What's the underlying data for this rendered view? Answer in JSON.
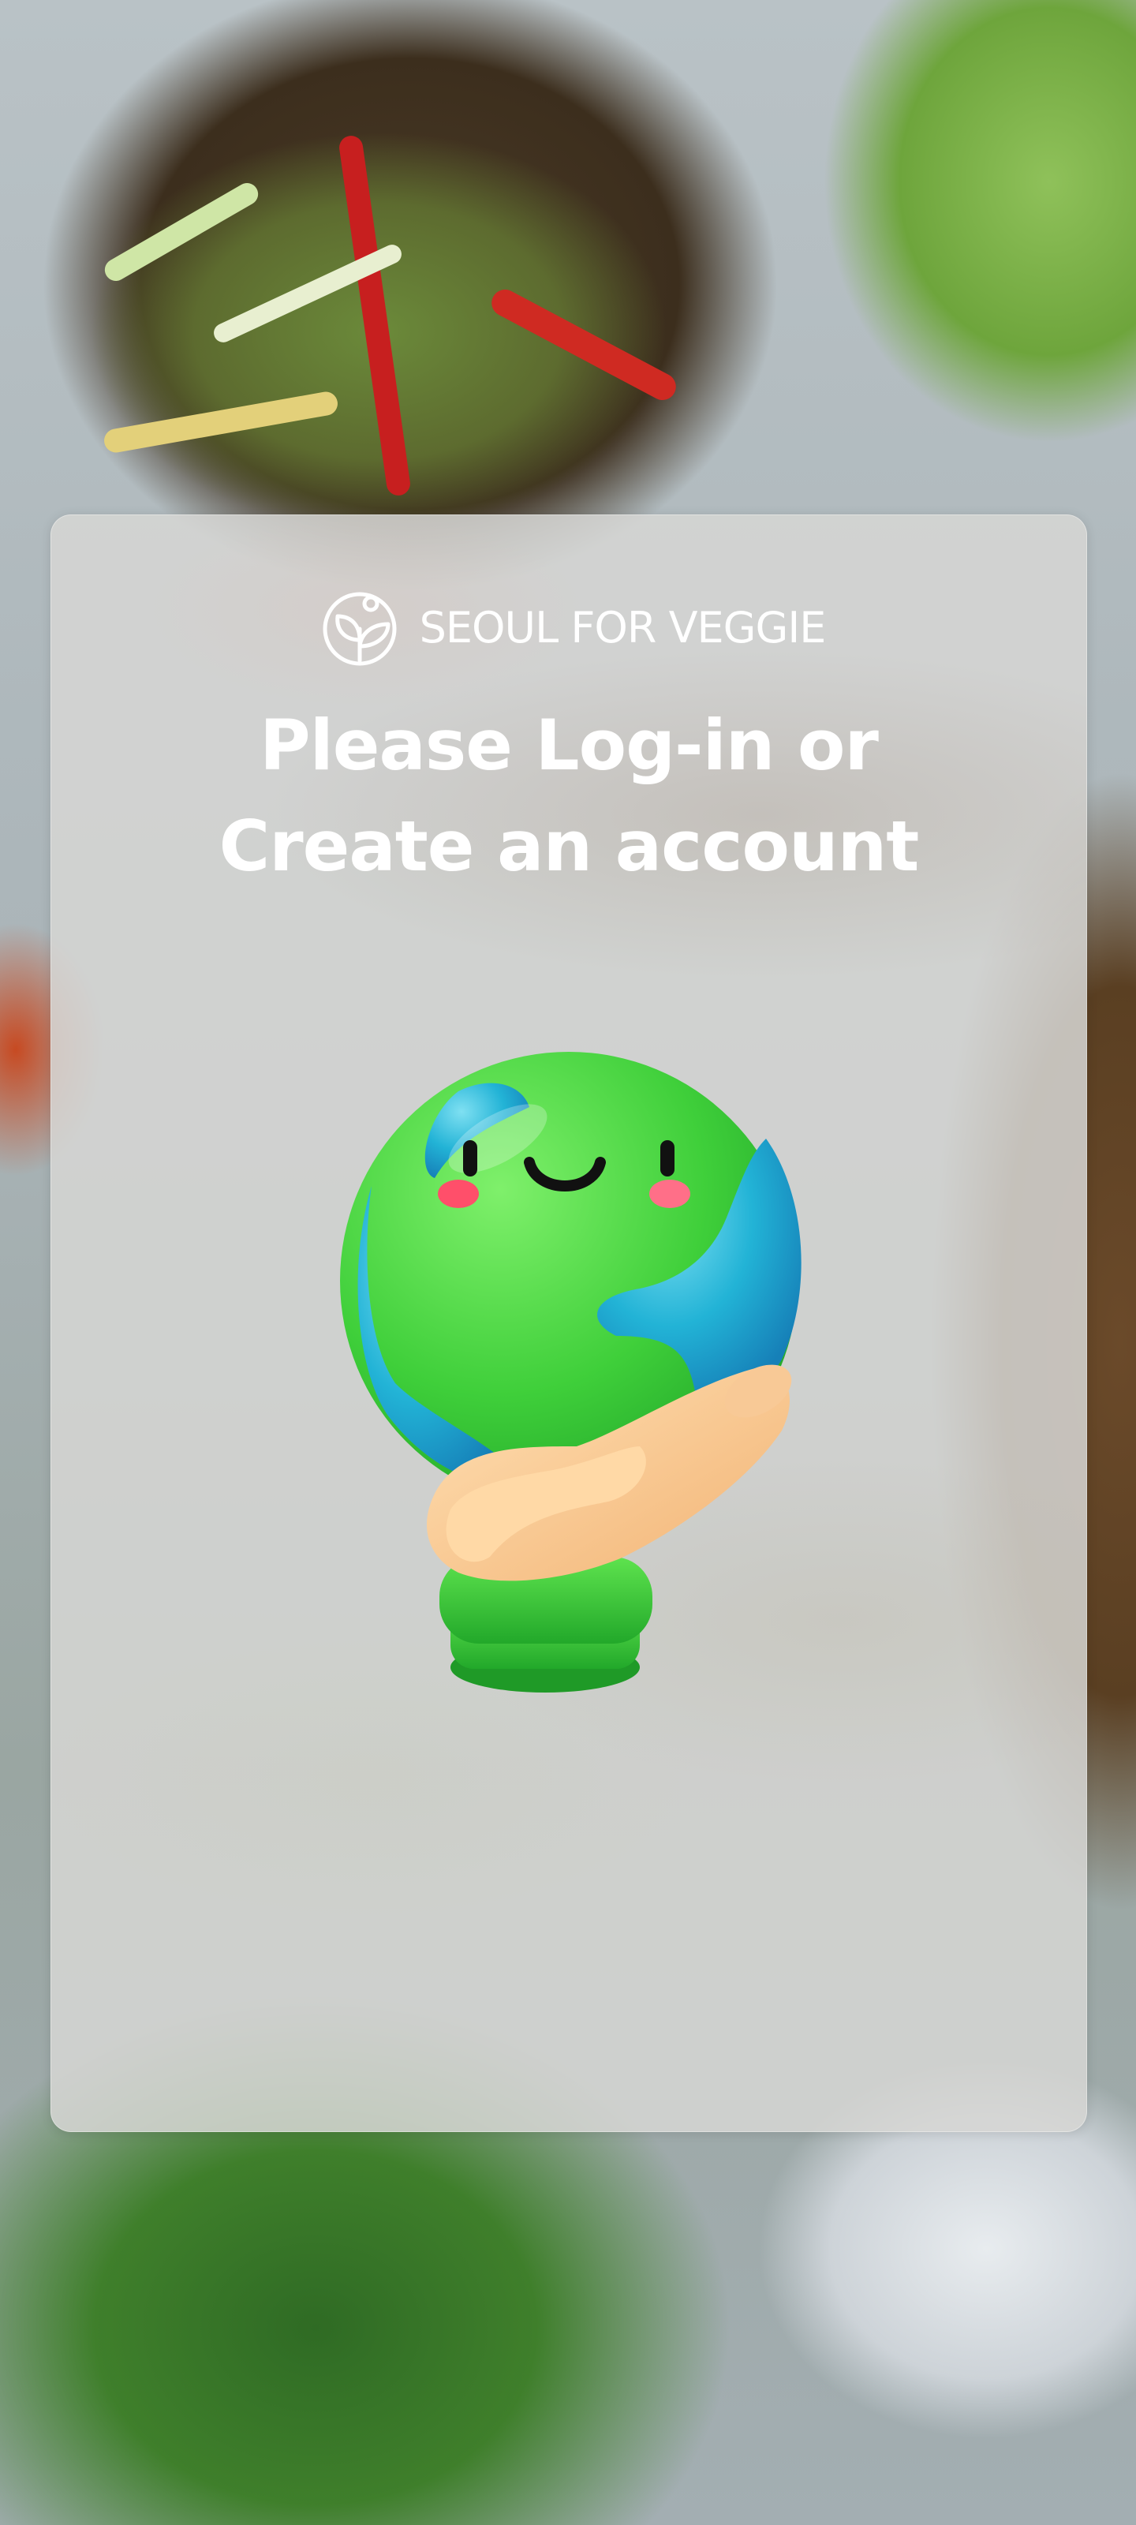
{
  "brand": {
    "name": "SEOUL FOR VEGGIE",
    "logo_icon": "leaf-circle-logo-icon"
  },
  "heading": {
    "line1": "Please Log-in or",
    "line2": "Create an account"
  },
  "illustration": {
    "icon": "earth-in-hand-illustration"
  },
  "colors": {
    "heading_text": "#ffffff",
    "card_background": "#d6d6d4",
    "globe_land": "#3fcf3a",
    "globe_ocean": "#2bb6d8",
    "hand_skin": "#f6c48c"
  }
}
